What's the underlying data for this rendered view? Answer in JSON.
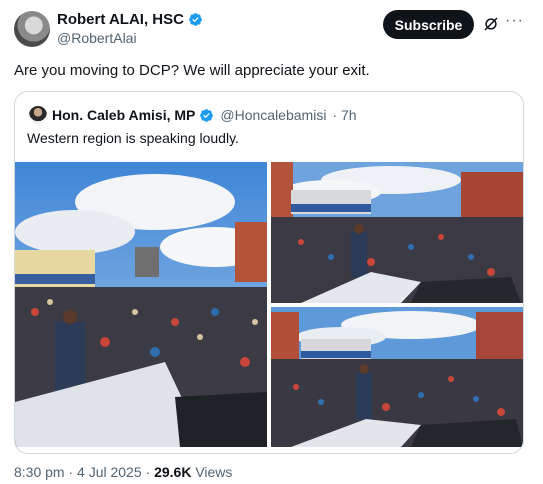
{
  "author": {
    "name": "Robert ALAI, HSC",
    "handle": "@RobertAlai"
  },
  "header": {
    "subscribe_label": "Subscribe",
    "more_label": "···"
  },
  "tweet": {
    "text": "Are you moving to DCP? We will appreciate your exit."
  },
  "quoted": {
    "name": "Hon. Caleb Amisi, MP",
    "handle": "@Honcalebamisi",
    "time": "· 7h",
    "text": "Western region is speaking loudly."
  },
  "meta": {
    "time": "8:30 pm · 4 Jul 2025 · ",
    "views_count": "29.6K",
    "views_label": " Views"
  },
  "colors": {
    "verified": "#1d9bf0",
    "subscribe_bg": "#0f1419",
    "secondary_text": "#536471",
    "border": "#cfd9de"
  },
  "icons": [
    "verified-badge-icon",
    "grok-icon",
    "more-options-icon"
  ]
}
